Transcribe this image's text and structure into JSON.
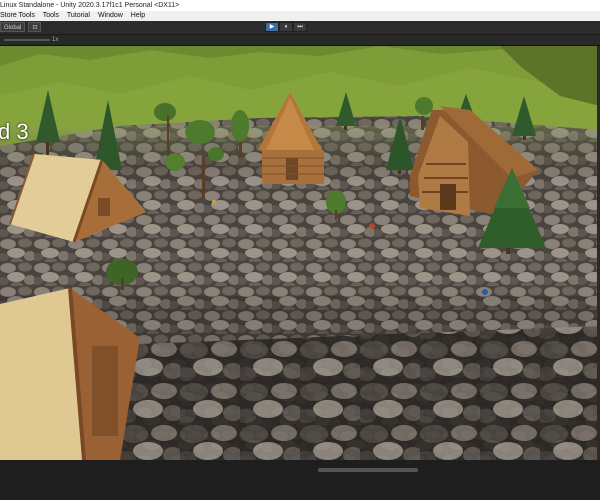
{
  "window": {
    "title": "Linux Standalone - Unity 2020.3.17f1c1 Personal <DX11>"
  },
  "menu": {
    "items": [
      "Store Tools",
      "Tools",
      "Tutorial",
      "Window",
      "Help"
    ]
  },
  "toolbar": {
    "left_buttons": [
      "Global"
    ],
    "play_icon": "▶",
    "pause_icon": "⏸",
    "step_icon": "⏭"
  },
  "game_view": {
    "scale_label": "1x"
  },
  "hud": {
    "level_text": "d 3"
  }
}
